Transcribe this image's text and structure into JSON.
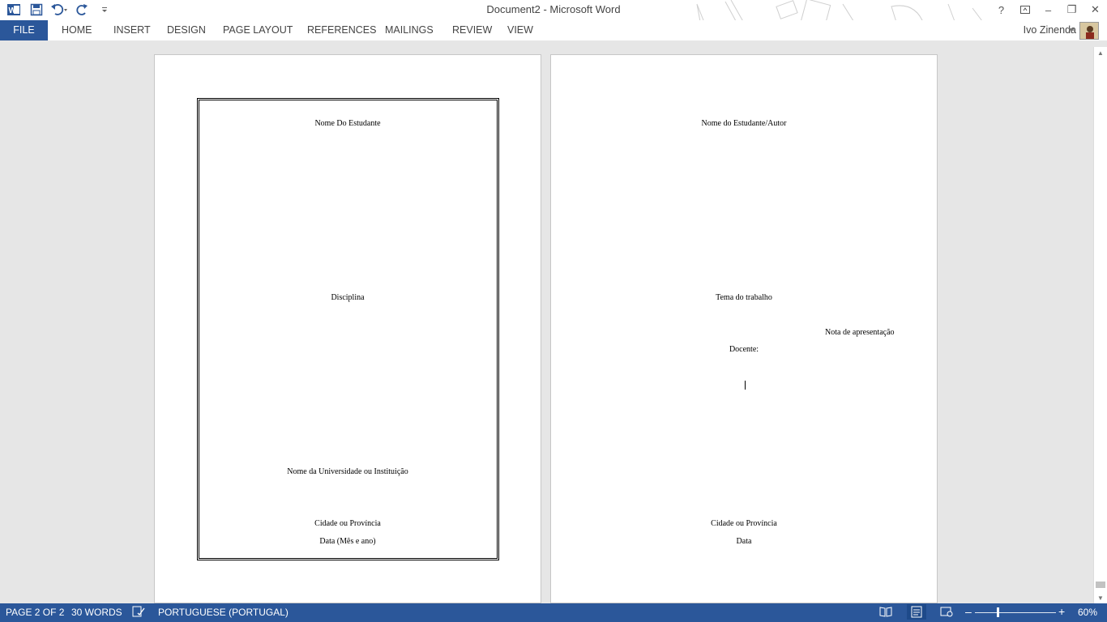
{
  "window": {
    "title": "Document2 - Microsoft Word"
  },
  "qat": {
    "icons": [
      "word-logo-icon",
      "save-icon",
      "undo-icon",
      "redo-icon",
      "customize-qat-icon"
    ]
  },
  "window_controls": {
    "help": "?",
    "minimize": "–",
    "restore": "❐",
    "close": "✕"
  },
  "ribbon": {
    "tabs": [
      "FILE",
      "HOME",
      "INSERT",
      "DESIGN",
      "PAGE LAYOUT",
      "REFERENCES",
      "MAILINGS",
      "REVIEW",
      "VIEW"
    ]
  },
  "user": {
    "name": "Ivo Zinenda"
  },
  "document": {
    "page1": {
      "student": "Nome Do Estudante",
      "subject": "Disciplina",
      "institution": "Nome da Universidade ou Instituição",
      "city": "Cidade ou Província",
      "date": "Data (Mês e ano)"
    },
    "page2": {
      "author": "Nome do Estudante/Autor",
      "topic": "Tema do trabalho",
      "note": "Nota de apresentação",
      "teacher": "Docente:",
      "city": "Cidade ou Província",
      "date": "Data"
    }
  },
  "statusbar": {
    "page": "PAGE 2 OF 2",
    "words": "30 WORDS",
    "language": "PORTUGUESE (PORTUGAL)",
    "zoom": "60%",
    "zoom_minus": "–",
    "zoom_plus": "+"
  }
}
